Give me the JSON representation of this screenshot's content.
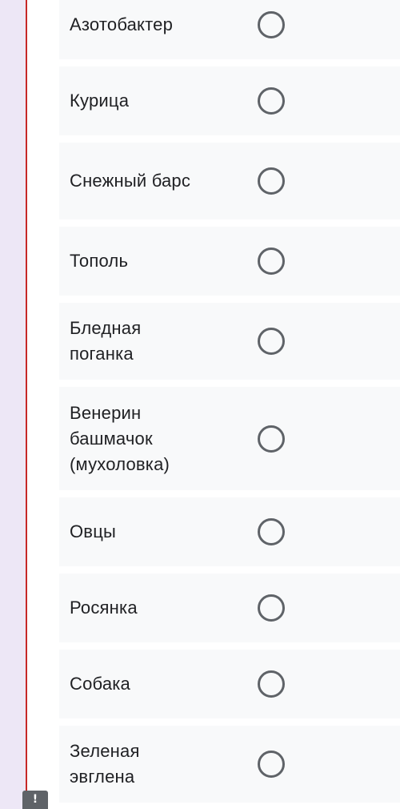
{
  "options": [
    {
      "label": "Азотобактер"
    },
    {
      "label": "Курица"
    },
    {
      "label": "Снежный барс"
    },
    {
      "label": "Тополь"
    },
    {
      "label": "Бледная поганка"
    },
    {
      "label": "Венерин башмачок (мухоловка)"
    },
    {
      "label": "Овцы"
    },
    {
      "label": "Росянка"
    },
    {
      "label": "Собака"
    },
    {
      "label": "Зеленая эвглена"
    }
  ],
  "warning_badge": {
    "label": "!"
  },
  "colors": {
    "accent_strip": "#ede7f6",
    "error_line": "#c62828",
    "row_background": "#f8f9fa",
    "radio_border": "#5f6368",
    "text": "#202124"
  }
}
